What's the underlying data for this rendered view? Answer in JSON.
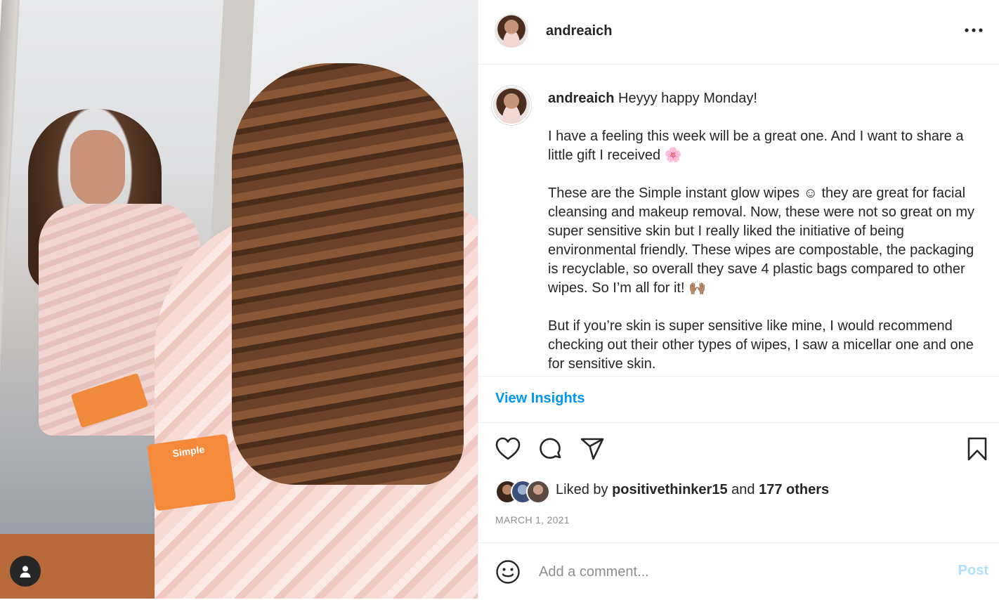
{
  "post": {
    "username": "andreaich",
    "caption_paragraphs": [
      "Heyyy happy Monday!",
      "I have a feeling this week will be a great one. And I want to share a little gift I received 🌸",
      "These are the Simple instant glow wipes ☺ they are great for facial cleansing and makeup removal. Now, these were not so great on my super sensitive skin but I really liked the initiative of being environmental friendly. These wipes are compostable, the packaging is recyclable, so overall they save 4 plastic bags compared to other wipes. So I’m all for it! 🙌🏽",
      "But if you’re skin is super sensitive like mine, I would recommend checking out their other types of wipes, I saw a micellar one and one for sensitive skin."
    ],
    "photo_product_label": "Simple",
    "view_insights": "View Insights",
    "likes": {
      "prefix": "Liked by",
      "user": "positivethinker15",
      "connector": "and",
      "others": "177 others"
    },
    "date": "MARCH 1, 2021",
    "comment": {
      "placeholder": "Add a comment...",
      "post_label": "Post"
    }
  },
  "icons": {
    "more": "more-options-icon",
    "like": "heart-icon",
    "comment": "comment-icon",
    "share": "paper-plane-icon",
    "save": "bookmark-icon",
    "emoji": "smiley-icon",
    "tagged_user": "user-icon"
  },
  "colors": {
    "link": "#0095f6",
    "post_disabled": "#b2dffc",
    "text": "#262626",
    "muted": "#8e8e8e"
  }
}
